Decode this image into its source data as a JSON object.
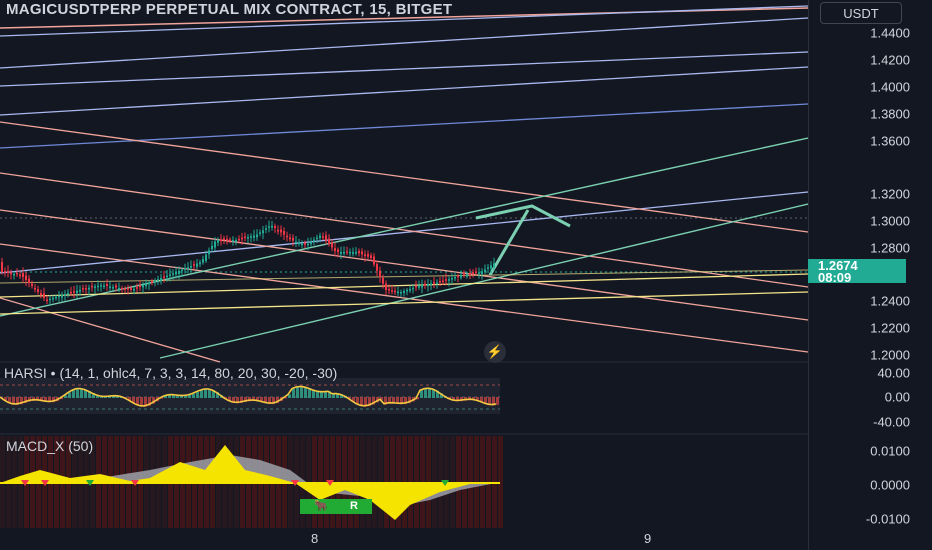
{
  "header": {
    "symbol_title": "MAGICUSDTPERP PERPETUAL MIX CONTRACT, 15, BITGET",
    "currency_label": "USDT"
  },
  "price_scale": {
    "ticks": [
      "1.4400",
      "1.4200",
      "1.4000",
      "1.3800",
      "1.3600",
      "1.3200",
      "1.3000",
      "1.2800",
      "1.2400",
      "1.2200",
      "1.2000"
    ],
    "last_price": "1.2674",
    "countdown": "08:09",
    "last_price_color": "#22ab94"
  },
  "harsi": {
    "legend": "HARSI • (14, 1, ohlc4, 7, 3, 3, 14, 80, 20, 30, -20, -30)",
    "ticks": [
      "40.00",
      "0.00",
      "-40.00"
    ]
  },
  "macd": {
    "legend": "MACD_X (50)",
    "ticks": [
      "0.0100",
      "0.0000",
      "-0.0100"
    ],
    "badge_left": "🐂",
    "badge_right": "R"
  },
  "time_axis": {
    "labels": [
      "8",
      "9"
    ]
  },
  "colors": {
    "background": "#131722",
    "up": "#22ab94",
    "down": "#f23645",
    "fib_blue": "#a9b9f0",
    "fib_salmon": "#f0a49a",
    "trend_green": "#7ad0b0",
    "support_yellow": "#f5e58a",
    "macd_yellow": "#f5e300"
  }
}
